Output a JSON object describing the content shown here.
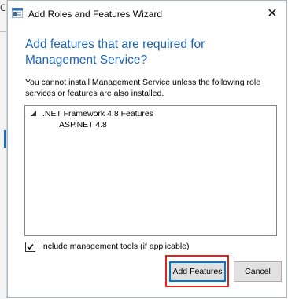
{
  "window": {
    "title": "Add Roles and Features Wizard",
    "close_glyph": "✕",
    "icon": "wizard-app-icon"
  },
  "background": {
    "edge_letter": "C"
  },
  "dialog": {
    "heading": "Add features that are required for Management Service?",
    "message": "You cannot install Management Service unless the following role services or features are also installed.",
    "features": [
      {
        "label": ".NET Framework 4.8 Features",
        "expanded": true,
        "expander": "▲"
      },
      {
        "label": "ASP.NET 4.8"
      }
    ],
    "include_tools": {
      "label": "Include management tools (if applicable)",
      "checked": true
    },
    "buttons": {
      "add": "Add Features",
      "cancel": "Cancel"
    }
  },
  "colors": {
    "heading": "#1c63b7",
    "highlight": "#e2231a",
    "default_button_border": "#0078d7"
  }
}
